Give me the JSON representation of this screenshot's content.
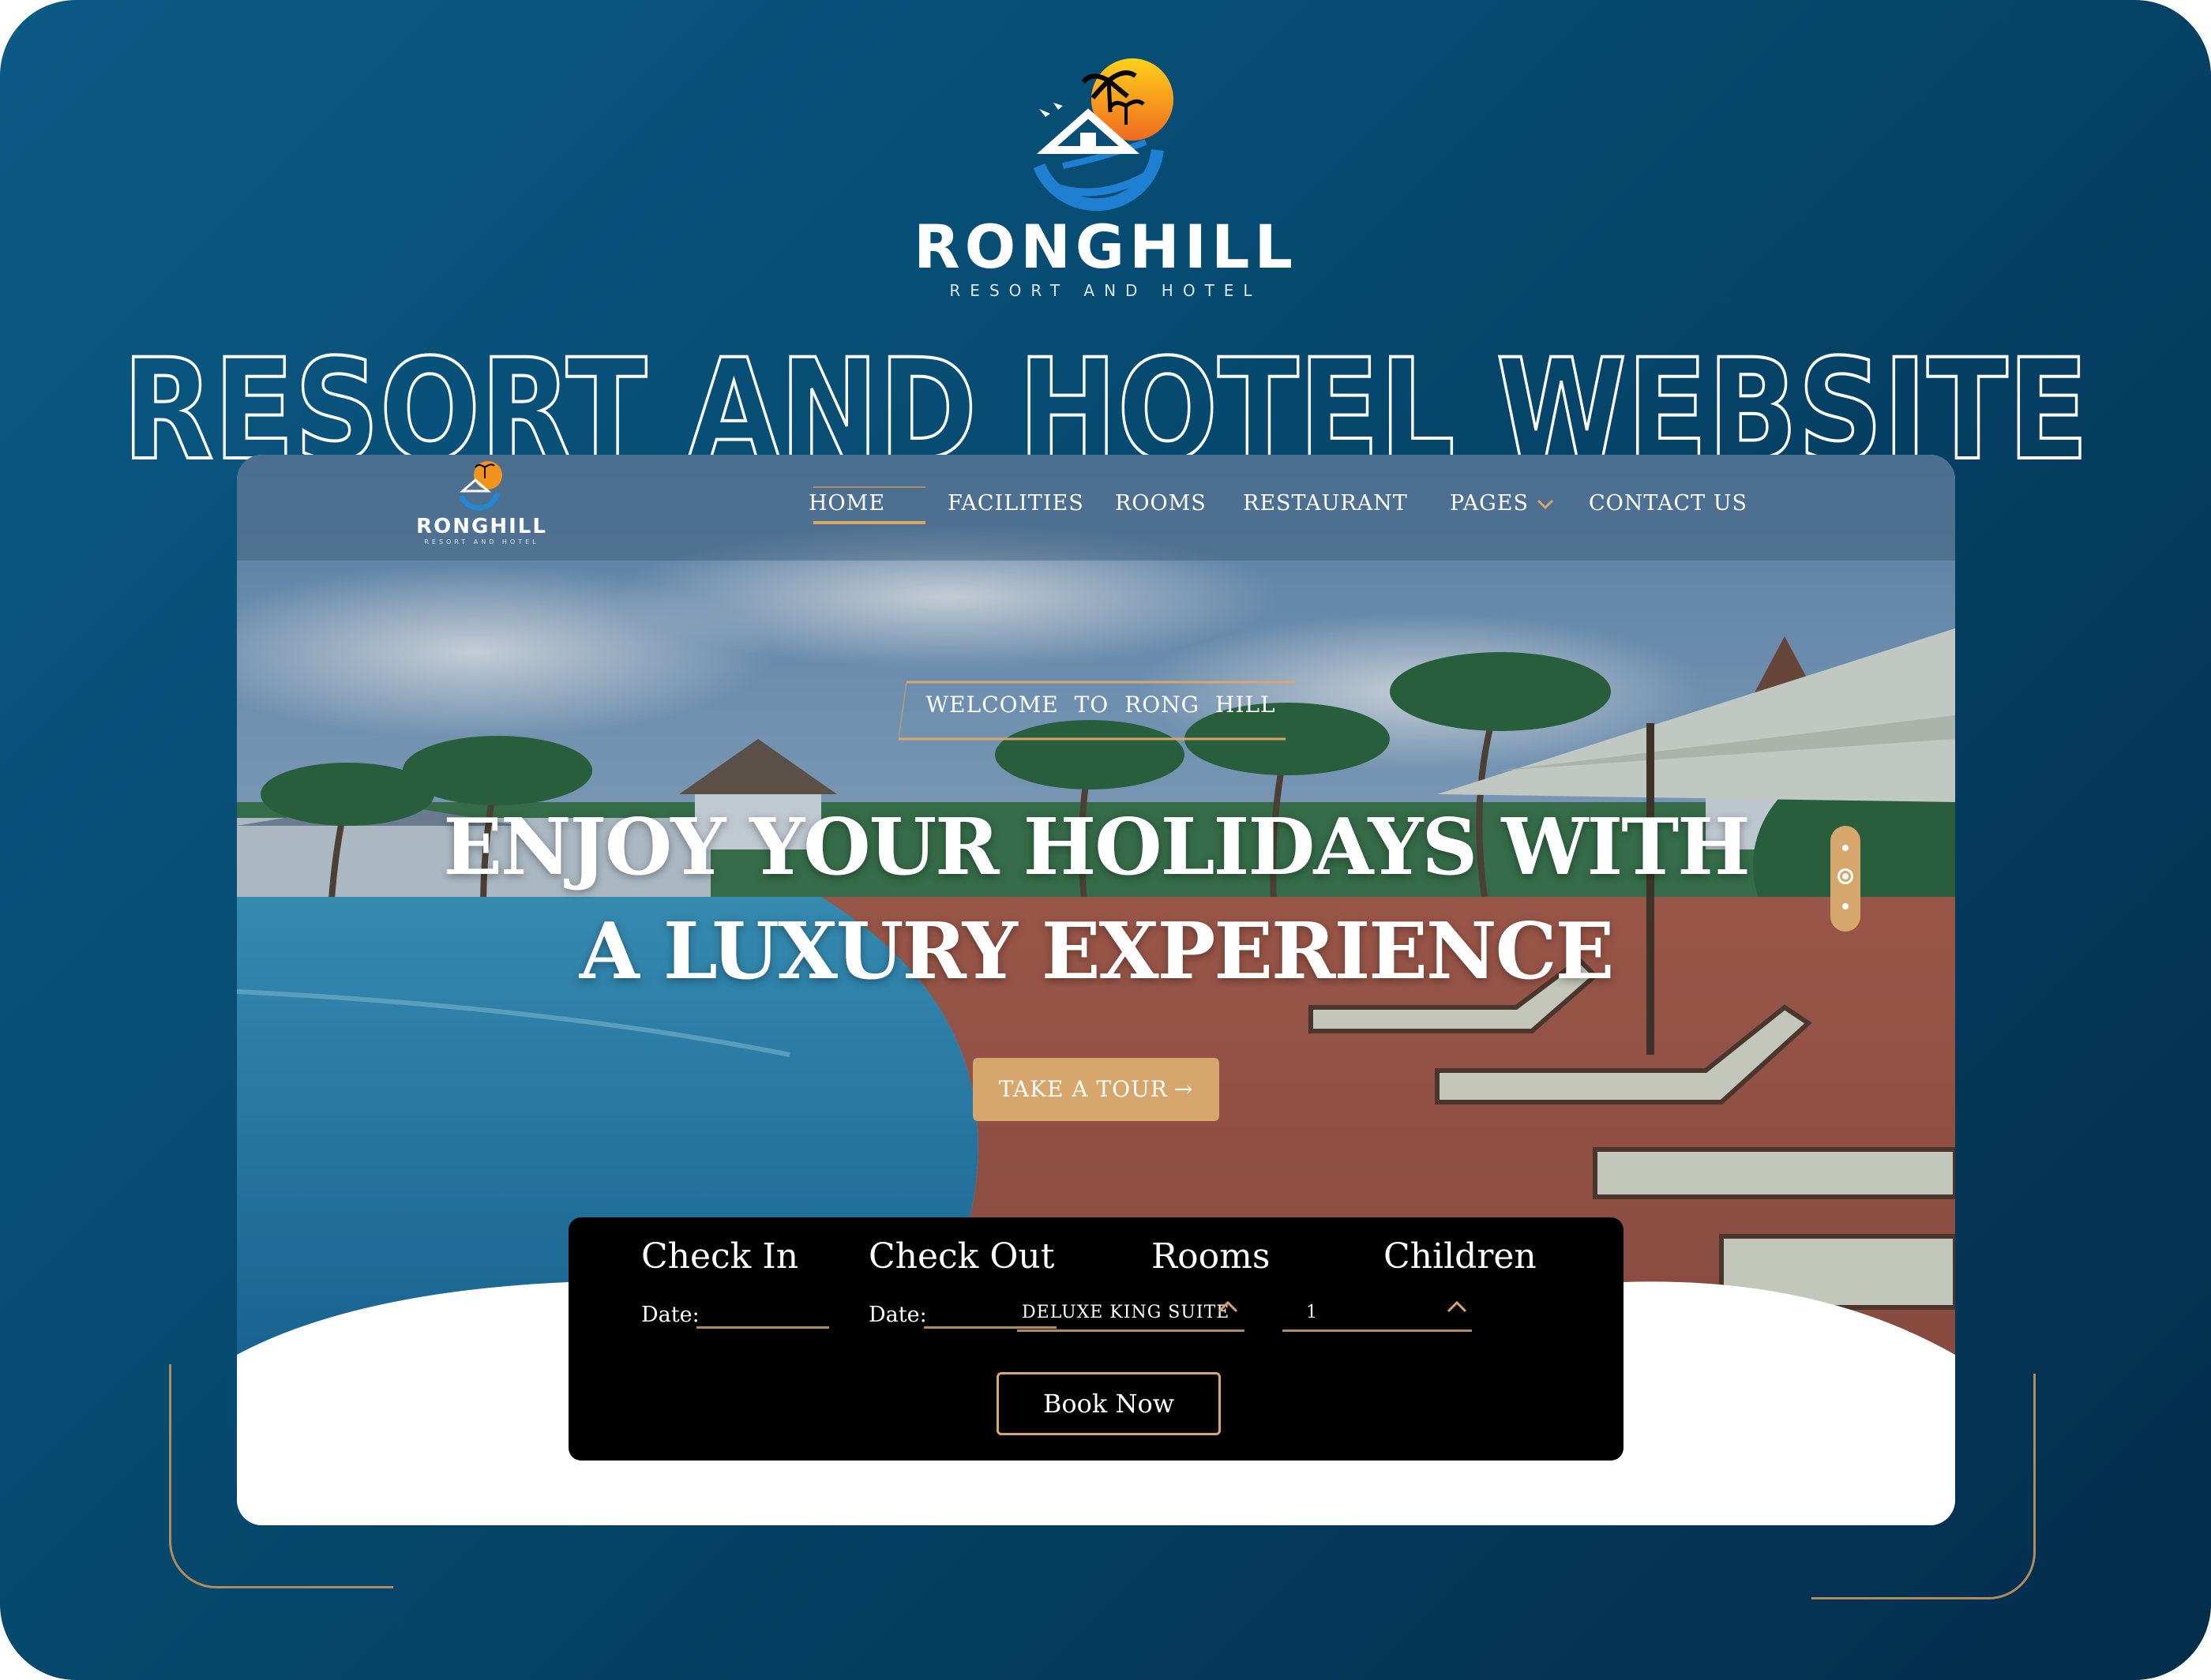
{
  "showcase": {
    "brand_name": "RONGHILL",
    "brand_tagline": "RESORT AND HOTEL",
    "headline": "RESORT AND HOTEL WEBSITE"
  },
  "colors": {
    "background_gradient": [
      "#0b5a85",
      "#032d4b"
    ],
    "accent_gold": "#d7a66c",
    "frame_gold": "#b28b5c",
    "booking_panel": "#000000"
  },
  "site": {
    "nav": {
      "brand_name": "RONGHILL",
      "brand_tagline": "RESORT AND HOTEL",
      "items": [
        {
          "label": "HOME",
          "active": true
        },
        {
          "label": "FACILITIES"
        },
        {
          "label": "ROOMS"
        },
        {
          "label": "RESTAURANT"
        },
        {
          "label": "PAGES",
          "icon": "chevron-down-icon"
        },
        {
          "label": "CONTACT US"
        }
      ]
    },
    "hero": {
      "welcome": "WELCOME TO RONG HILL",
      "title_line1": "ENJOY YOUR HOLIDAYS WITH",
      "title_line2": "A LUXURY EXPERIENCE",
      "tour_button": "TAKE A TOUR",
      "tour_icon": "arrow-right-icon",
      "slider": {
        "count": 3,
        "active_index": 1
      }
    },
    "booking": {
      "check_in": {
        "heading": "Check In",
        "label": "Date:"
      },
      "check_out": {
        "heading": "Check Out",
        "label": "Date:"
      },
      "rooms": {
        "heading": "Rooms",
        "value": "DELUXE KING SUITE",
        "icon": "chevron-up-icon"
      },
      "children": {
        "heading": "Children",
        "value": "1",
        "icon": "chevron-up-icon"
      },
      "book_button": "Book Now"
    }
  }
}
